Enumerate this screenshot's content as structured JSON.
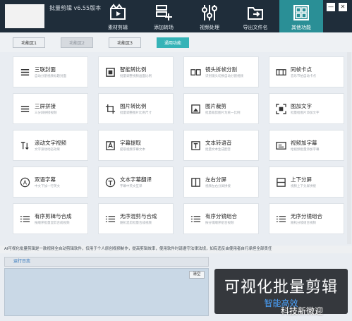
{
  "header": {
    "title": "批量剪辑 v6.55版本",
    "nav": [
      {
        "label": "素材剪辑",
        "icon": "film-icon"
      },
      {
        "label": "添加转场",
        "icon": "transition-icon"
      },
      {
        "label": "视频处理",
        "icon": "sliders-icon"
      },
      {
        "label": "导出文件名",
        "icon": "export-folder-icon"
      },
      {
        "label": "其他功能",
        "icon": "grid-icon",
        "active": true
      }
    ],
    "minimize": "—",
    "close": "✕"
  },
  "tabs": [
    {
      "label": "功能区1",
      "state": "normal"
    },
    {
      "label": "功能区2",
      "state": "dim"
    },
    {
      "label": "功能区3",
      "state": "normal"
    },
    {
      "label": "通用功能",
      "state": "active"
    }
  ],
  "cards": [
    {
      "title": "三联封面",
      "sub": "自动分割视频标题封面",
      "icon": "three-frame-icon"
    },
    {
      "title": "智能转比例",
      "sub": "批量调整视频画面比例",
      "icon": "film-ratio-icon"
    },
    {
      "title": "镜头拆帧分割",
      "sub": "识别镜头切换自动分割视频",
      "icon": "split-frame-icon"
    },
    {
      "title": "同帧卡点",
      "sub": "音乐节拍自动卡点",
      "icon": "beat-sync-icon"
    },
    {
      "title": "三屏拼接",
      "sub": "三分屏拼接视频",
      "icon": "triple-screen-icon"
    },
    {
      "title": "图片转比例",
      "sub": "批量调整图片比例尺寸",
      "icon": "image-ratio-icon"
    },
    {
      "title": "图片裁剪",
      "sub": "批量裁剪图片为统一比例",
      "icon": "crop-icon"
    },
    {
      "title": "图加文字",
      "sub": "批量给图片添加文字",
      "icon": "image-text-icon"
    },
    {
      "title": "滚动文字视频",
      "sub": "文字滚动动态效果",
      "icon": "scroll-text-icon"
    },
    {
      "title": "字幕提取",
      "sub": "提取视频字幕文本",
      "icon": "subtitle-extract-icon"
    },
    {
      "title": "文本转语音",
      "sub": "批量文本生成配音",
      "icon": "text-to-speech-icon"
    },
    {
      "title": "视频加字幕",
      "sub": "给视频批量添加字幕",
      "icon": "add-subtitle-icon"
    },
    {
      "title": "双语字幕",
      "sub": "中文下加一行英文",
      "icon": "bilingual-icon"
    },
    {
      "title": "文本字幕翻译",
      "sub": "字幕中英文互译",
      "icon": "translate-icon"
    },
    {
      "title": "左右分屏",
      "sub": "视频左右分屏拼接",
      "icon": "split-lr-icon"
    },
    {
      "title": "上下分屏",
      "sub": "视频上下分屏拼接",
      "icon": "split-tb-icon"
    },
    {
      "title": "有序剪辑与合成",
      "sub": "按顺序批量混剪合成视频",
      "icon": "ordered-list-icon"
    },
    {
      "title": "无序混剪与合成",
      "sub": "随机混剪批量合成视频",
      "icon": "shuffle-list-icon"
    },
    {
      "title": "有序分镜组合",
      "sub": "按分镜顺序组合视频",
      "icon": "ordered-storyboard-icon"
    },
    {
      "title": "无序分镜组合",
      "sub": "随机分镜组合视频",
      "icon": "shuffle-storyboard-icon"
    }
  ],
  "notice": "AI可视化批量剪辑是一款视频全自动剪辑软件，仅用于个人原创视频制作，提高剪辑效率，使用软件时请遵守法律法规，如有违反由使用者自行承担全部责任",
  "log": {
    "title": "运行日志",
    "clear": "清空"
  },
  "promo": {
    "title": "可视化批量剪辑",
    "subtitle": "智能高效"
  },
  "watermark": "科技新微迎",
  "colors": {
    "header_bg": "#1f2d3a",
    "accent": "#35b3b7",
    "active_nav": "#2a8f96",
    "promo_bg": "#35383d",
    "promo_sub": "#4aa3ff"
  }
}
